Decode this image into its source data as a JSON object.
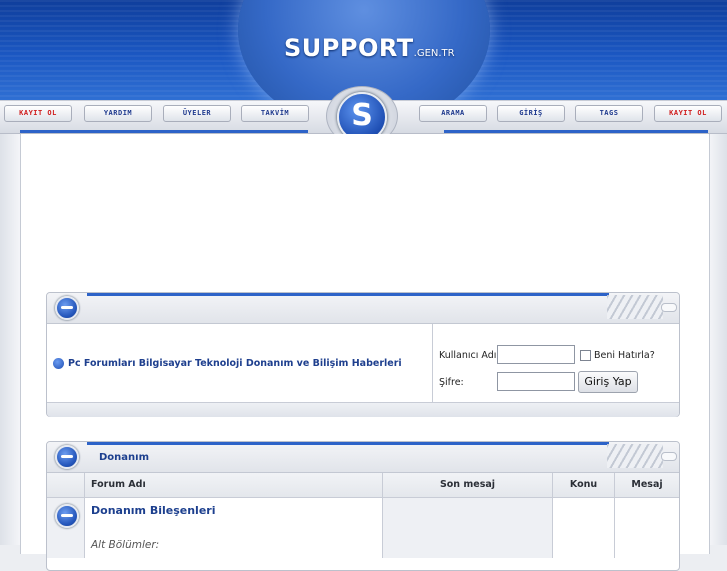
{
  "brand": {
    "logo_main": "SUPPORT",
    "logo_suffix": ".GEN.TR",
    "badge_letter": "S"
  },
  "nav": {
    "left": [
      "KAYIT OL",
      "YARDIM",
      "ÜYELER",
      "TAKVİM"
    ],
    "right": [
      "ARAMA",
      "GİRİŞ",
      "TAGS",
      "KAYIT OL"
    ]
  },
  "login_panel": {
    "site_title": "Pc Forumları Bilgisayar Teknoloji Donanım ve Bilişim Haberleri",
    "username_label": "Kullanıcı Adı:",
    "username_value": "",
    "remember_label": "Beni Hatırla?",
    "password_label": "Şifre:",
    "password_value": "",
    "submit_label": "Giriş Yap"
  },
  "forum_table": {
    "category": "Donanım",
    "columns": [
      "Forum Adı",
      "Son mesaj",
      "Konu",
      "Mesaj"
    ],
    "rows": [
      {
        "name": "Donanım Bileşenleri",
        "sub": "Alt Bölümler:"
      }
    ]
  },
  "colors": {
    "brand_blue": "#1b57c2",
    "link_blue": "#1c3f8e",
    "nav_red": "#cf1c1c"
  },
  "icons": [
    "orb-minus-icon",
    "arrow-circle-icon",
    "bullet-icon"
  ]
}
